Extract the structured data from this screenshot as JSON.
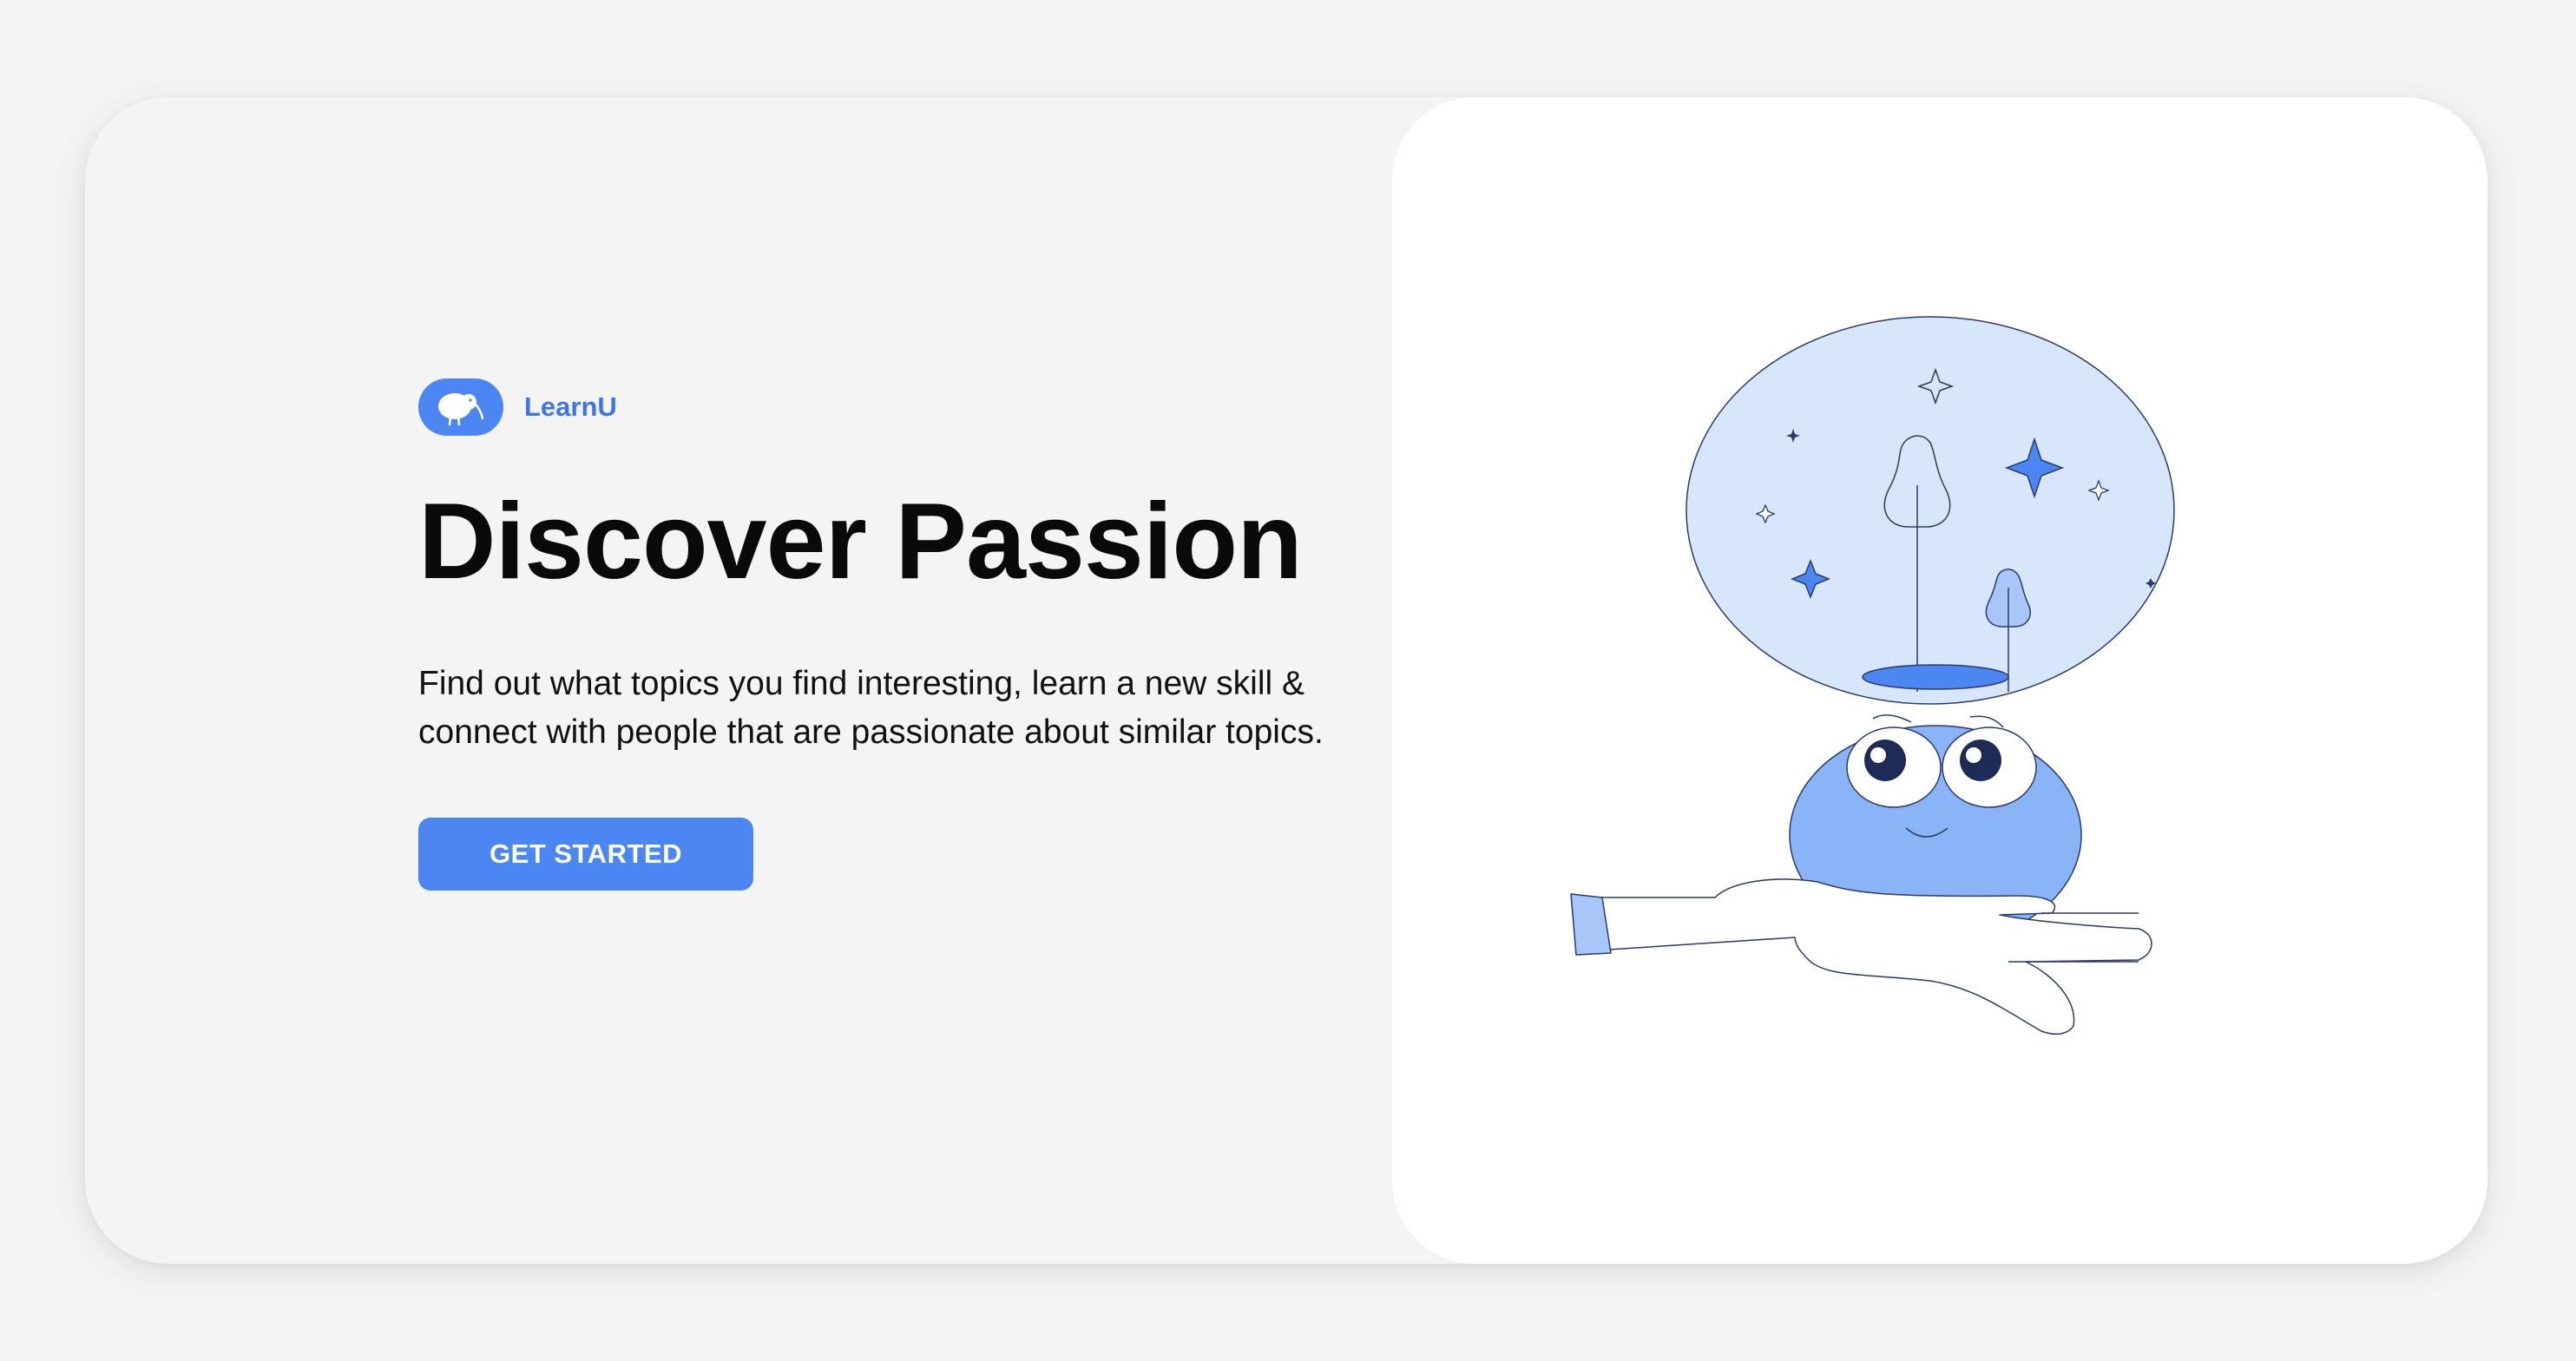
{
  "brand": {
    "name": "LearnU",
    "logo_icon": "kiwi-bird-icon"
  },
  "hero": {
    "title": "Discover Passion",
    "description": "Find out what topics you find interesting, learn a new skill & connect with people that are passionate about similar topics.",
    "cta_label": "GET STARTED"
  },
  "illustration": {
    "icon": "mind-bulb-hand-illustration"
  },
  "colors": {
    "accent": "#4c86f3",
    "brand_text": "#3c76e8",
    "background": "#f4f4f4",
    "panel": "#ffffff",
    "bubble": "#d8e6fc",
    "head": "#8ab4f8"
  }
}
